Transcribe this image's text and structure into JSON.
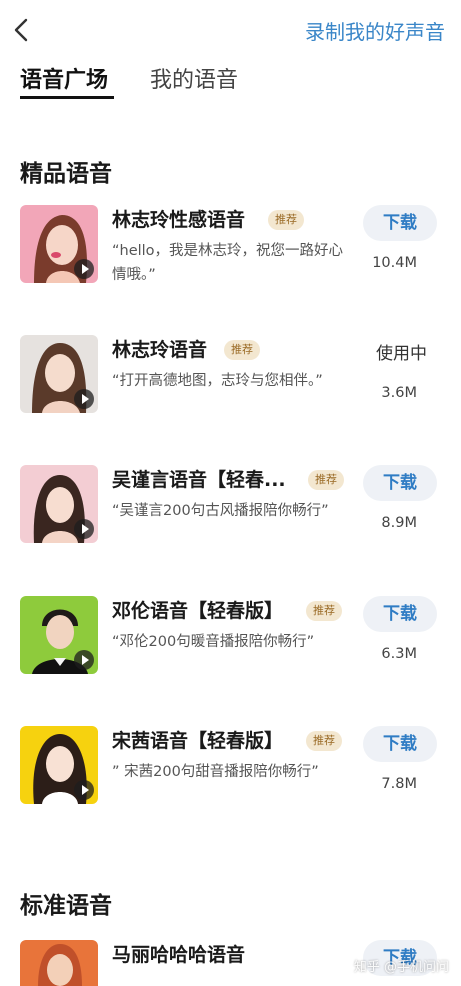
{
  "header": {
    "record_link": "录制我的好声音",
    "back_icon": "chevron-left-icon"
  },
  "tabs": [
    {
      "label": "语音广场",
      "active": true
    },
    {
      "label": "我的语音",
      "active": false
    }
  ],
  "sections": {
    "premium_title": "精品语音",
    "standard_title": "标准语音"
  },
  "premium_voices": [
    {
      "name": "林志玲性感语音",
      "badge": "推荐",
      "desc": "“hello，我是林志玲，祝您一路好心情哦。”",
      "action": "下载",
      "size": "10.4M"
    },
    {
      "name": "林志玲语音",
      "badge": "推荐",
      "desc": "“打开高德地图，志玲与您相伴。”",
      "action": "使用中",
      "size": "3.6M"
    },
    {
      "name": "吴谨言语音【轻春...",
      "badge": "推荐",
      "desc": "“吴谨言200句古风播报陪你畅行”",
      "action": "下载",
      "size": "8.9M"
    },
    {
      "name": "邓伦语音【轻春版】",
      "badge": "推荐",
      "desc": "“邓伦200句暖音播报陪你畅行”",
      "action": "下载",
      "size": "6.3M"
    },
    {
      "name": "宋茜语音【轻春版】",
      "badge": "推荐",
      "desc": "” 宋茜200句甜音播报陪你畅行”",
      "action": "下载",
      "size": "7.8M"
    }
  ],
  "standard_voices": [
    {
      "name": "马丽哈哈哈语音",
      "action": "下载"
    }
  ],
  "watermark": "知乎 @手机问问"
}
